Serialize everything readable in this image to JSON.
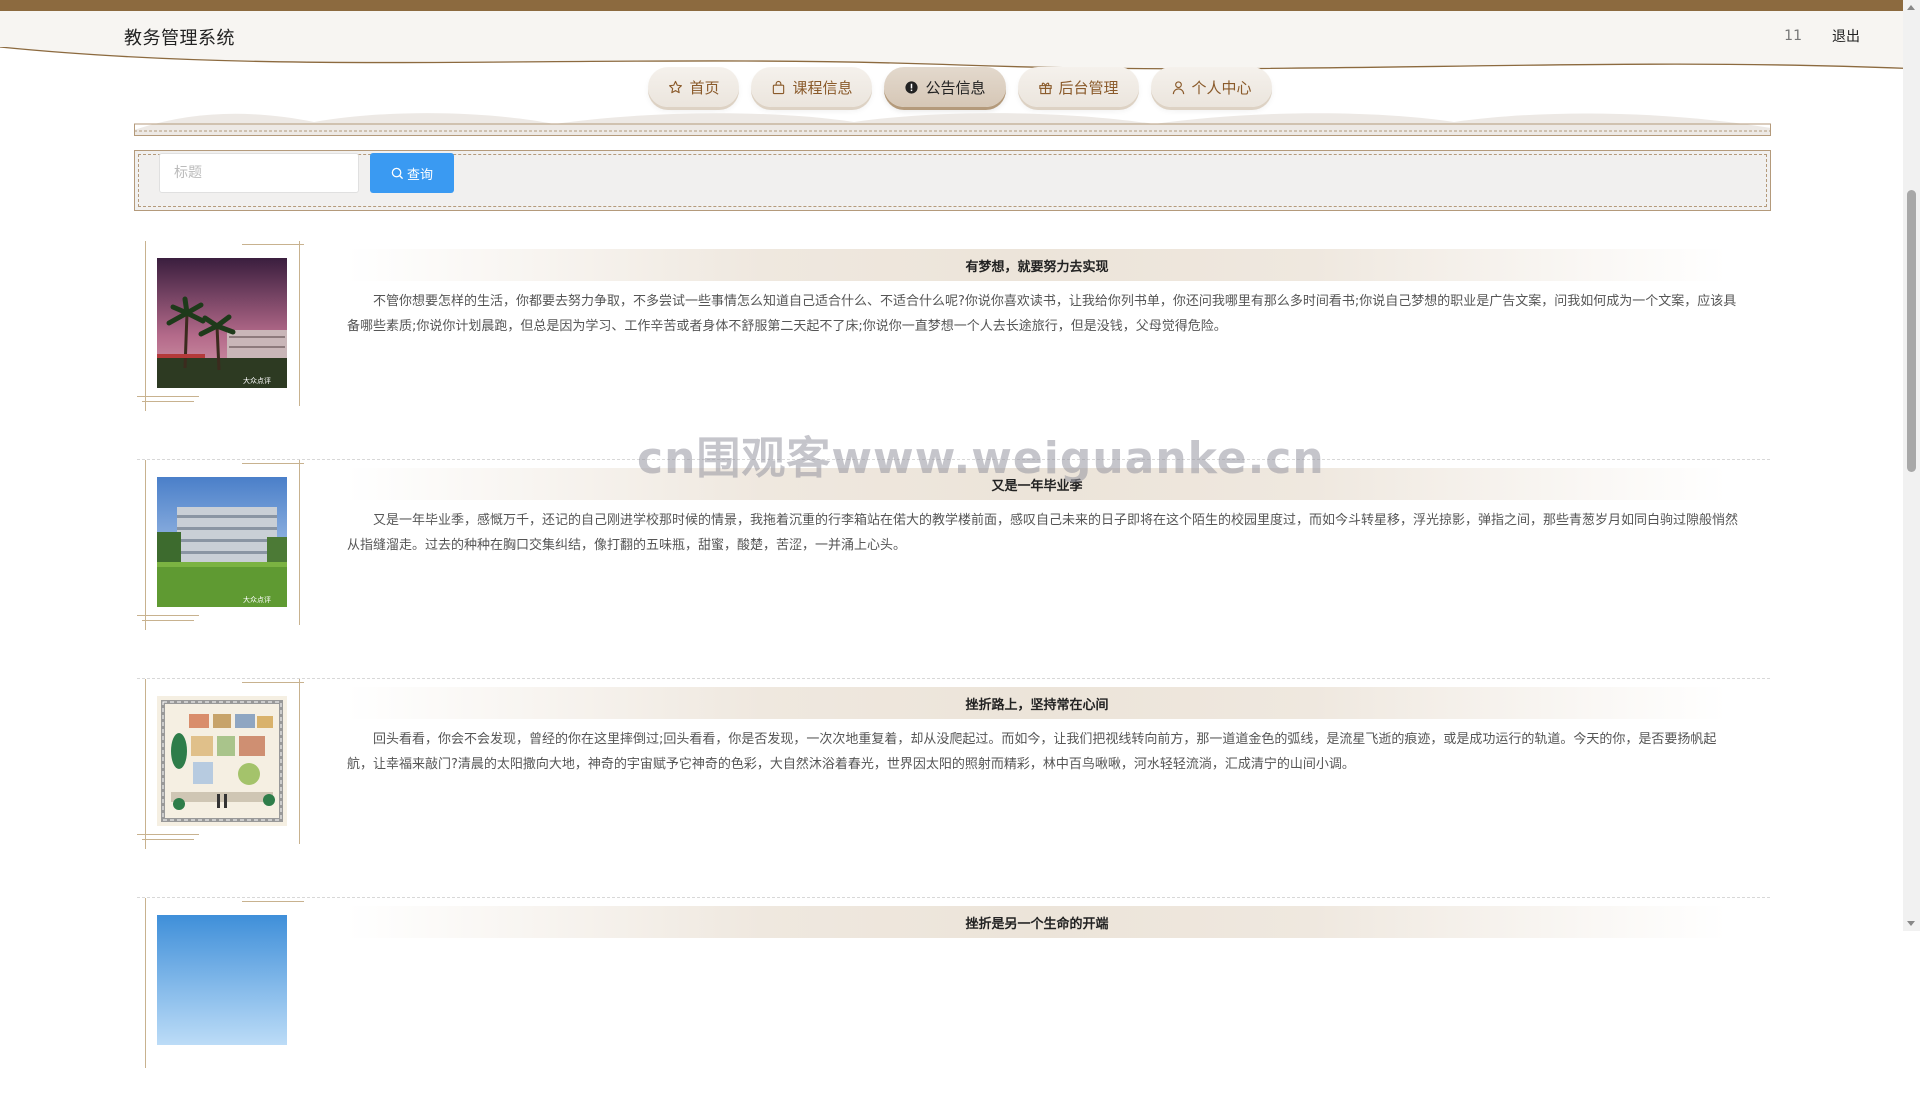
{
  "header": {
    "app_title": "教务管理系统",
    "user_name": "11",
    "logout_label": "退出"
  },
  "nav": {
    "items": [
      {
        "label": "首页",
        "icon": "star-icon",
        "active": false
      },
      {
        "label": "课程信息",
        "icon": "bag-icon",
        "active": false
      },
      {
        "label": "公告信息",
        "icon": "alert-circle-icon",
        "active": true
      },
      {
        "label": "后台管理",
        "icon": "gift-icon",
        "active": false
      },
      {
        "label": "个人中心",
        "icon": "user-icon",
        "active": false
      }
    ]
  },
  "search": {
    "placeholder": "标题",
    "value": "",
    "button_label": "查询",
    "button_icon": "search-icon"
  },
  "notices": [
    {
      "title": "有梦想，就要努力去实现",
      "content": "不管你想要怎样的生活，你都要去努力争取，不多尝试一些事情怎么知道自己适合什么、不适合什么呢?你说你喜欢读书，让我给你列书单，你还问我哪里有那么多时间看书;你说自己梦想的职业是广告文案，问我如何成为一个文案，应该具备哪些素质;你说你计划晨跑，但总是因为学习、工作辛苦或者身体不舒服第二天起不了床;你说你一直梦想一个人去长途旅行，但是没钱，父母觉得危险。",
      "image": "campus-night-palm-trees"
    },
    {
      "title": "又是一年毕业季",
      "content": "又是一年毕业季，感慨万千，还记的自己刚进学校那时候的情景，我拖着沉重的行李箱站在偌大的教学楼前面，感叹自己未来的日子即将在这个陌生的校园里度过，而如今斗转星移，浮光掠影，弹指之间，那些青葱岁月如同白驹过隙般悄然从指缝溜走。过去的种种在胸口交集纠结，像打翻的五味瓶，甜蜜，酸楚，苦涩，一并涌上心头。",
      "image": "campus-building-lawn"
    },
    {
      "title": "挫折路上，坚持常在心间",
      "content": "回头看看，你会不会发现，曾经的你在这里摔倒过;回头看看，你是否发现，一次次地重复着，却从没爬起过。而如今，让我们把视线转向前方，那一道道金色的弧线，是流星飞逝的痕迹，或是成功运行的轨道。今天的你，是否要扬帆起航，让幸福来敲门?清晨的太阳撒向大地，神奇的宇宙赋予它神奇的色彩，大自然沐浴着春光，世界因太阳的照射而精彩，林中百鸟啾啾，河水轻轻流淌，汇成清宁的山间小调。",
      "image": "campus-map-illustration"
    },
    {
      "title": "挫折是另一个生命的开端",
      "content": "",
      "image": "sky-photo"
    }
  ],
  "watermark": "cn围观客www.weiguanke.cn",
  "colors": {
    "top_stripe": "#8c6a3f",
    "nav_text": "#8a5a2a",
    "search_button": "#3a9af2",
    "frame_gold": "#c8b28f"
  }
}
